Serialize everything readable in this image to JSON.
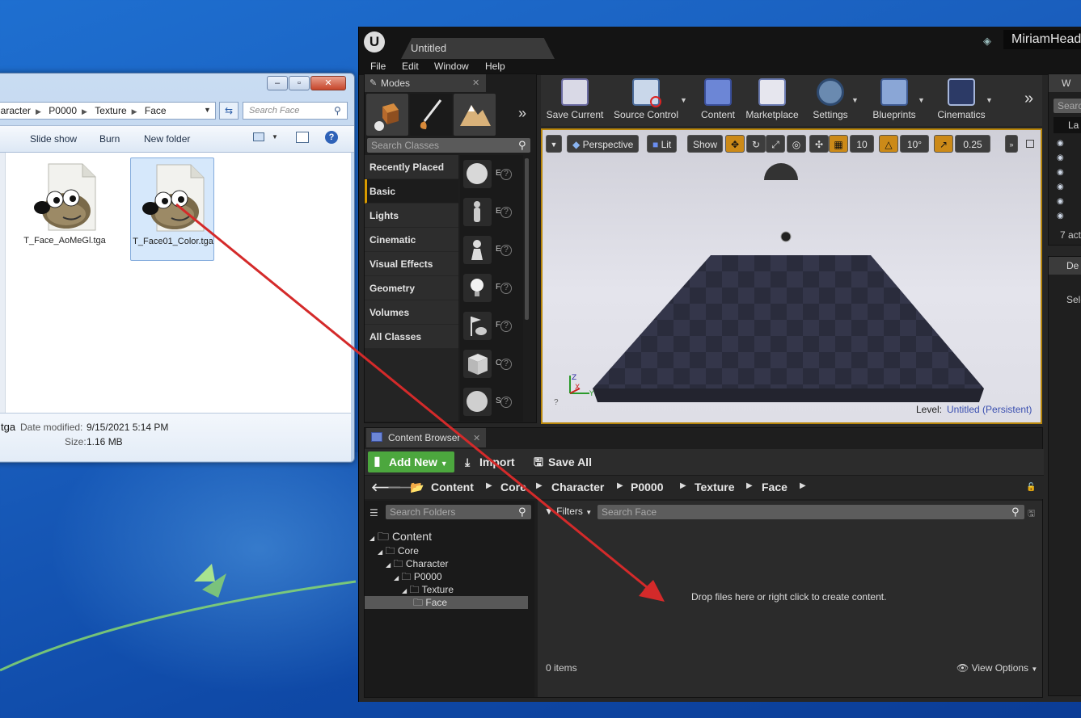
{
  "explorer": {
    "breadcrumb": [
      "haracter",
      "P0000",
      "Texture",
      "Face"
    ],
    "search_placeholder": "Search Face",
    "toolbar": [
      "Slide show",
      "Burn",
      "New folder"
    ],
    "files": [
      {
        "name": "T_Face_AoMeGl.tga",
        "selected": false
      },
      {
        "name": "T_Face01_Color.tga",
        "selected": true
      }
    ],
    "details": {
      "filename_tail": "tga",
      "date_label": "Date modified:",
      "date_value": "9/15/2021 5:14 PM",
      "size_label": "Size:",
      "size_value": "1.16 MB"
    },
    "window_buttons": [
      "minimize",
      "maximize",
      "close"
    ]
  },
  "ue": {
    "tab_title": "Untitled",
    "project_name": "MiriamHead",
    "menu": [
      "File",
      "Edit",
      "Window",
      "Help"
    ],
    "modes": {
      "tab_label": "Modes",
      "search_placeholder": "Search Classes",
      "categories": [
        "Recently Placed",
        "Basic",
        "Lights",
        "Cinematic",
        "Visual Effects",
        "Geometry",
        "Volumes",
        "All Classes"
      ],
      "active_category": "Basic",
      "asset_initials": [
        "E",
        "E",
        "E",
        "F",
        "F",
        "C",
        "S"
      ]
    },
    "toolbar": [
      "Save Current",
      "Source Control",
      "Content",
      "Marketplace",
      "Settings",
      "Blueprints",
      "Cinematics"
    ],
    "viewport": {
      "perspective": "Perspective",
      "lit": "Lit",
      "show": "Show",
      "grid_snap": "10",
      "rot_snap": "10°",
      "scale_snap": "0.25",
      "level_label": "Level:",
      "level_value": "Untitled (Persistent)"
    },
    "right_panel": {
      "search_label": "Searc",
      "col_label": "La",
      "count": "7 act",
      "details_tab": "De",
      "details_text": "Sele",
      "top_tab": "W"
    },
    "content_browser": {
      "tab_label": "Content Browser",
      "add_new": "Add New",
      "import": "Import",
      "save_all": "Save All",
      "path": [
        "Content",
        "Core",
        "Character",
        "P0000",
        "Texture",
        "Face"
      ],
      "search_folders": "Search Folders",
      "filters": "Filters",
      "search_assets": "Search Face",
      "tree": [
        {
          "label": "Content",
          "depth": 0
        },
        {
          "label": "Core",
          "depth": 1
        },
        {
          "label": "Character",
          "depth": 2
        },
        {
          "label": "P0000",
          "depth": 3
        },
        {
          "label": "Texture",
          "depth": 4
        },
        {
          "label": "Face",
          "depth": 5
        }
      ],
      "drop_message": "Drop files here or right click to create content.",
      "items_count": "0 items",
      "view_options": "View Options"
    }
  },
  "colors": {
    "ue_accent": "#d89a00",
    "add_new_green": "#4ca73e",
    "drag_arrow": "#d42a2a"
  }
}
